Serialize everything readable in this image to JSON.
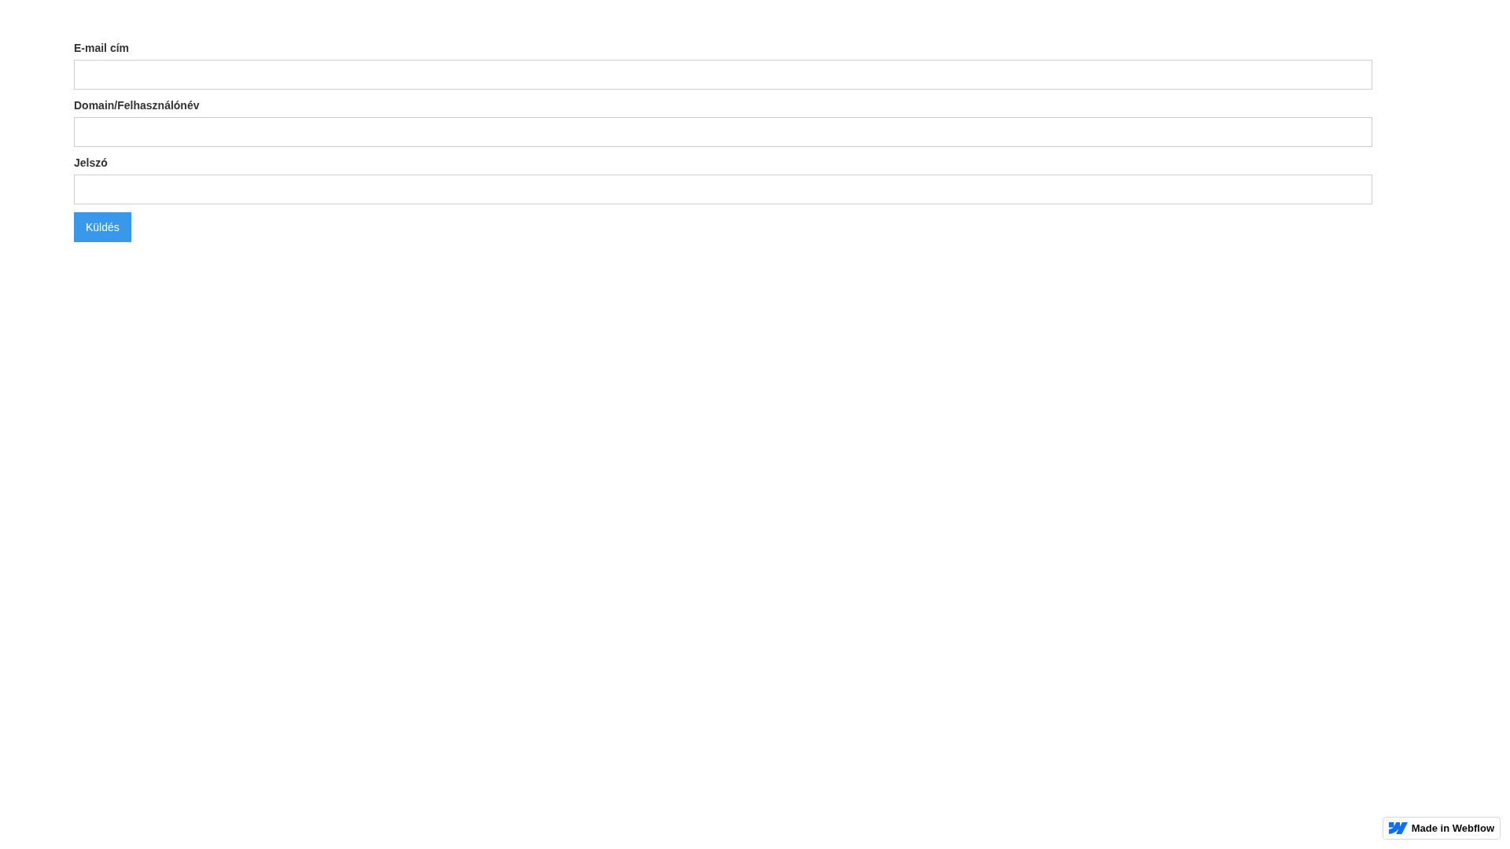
{
  "form": {
    "fields": [
      {
        "label": "E-mail cím"
      },
      {
        "label": "Domain/Felhasználónév"
      },
      {
        "label": "Jelszó"
      }
    ],
    "submit_button": "Küldés"
  },
  "badge": {
    "text": "Made in Webflow"
  }
}
